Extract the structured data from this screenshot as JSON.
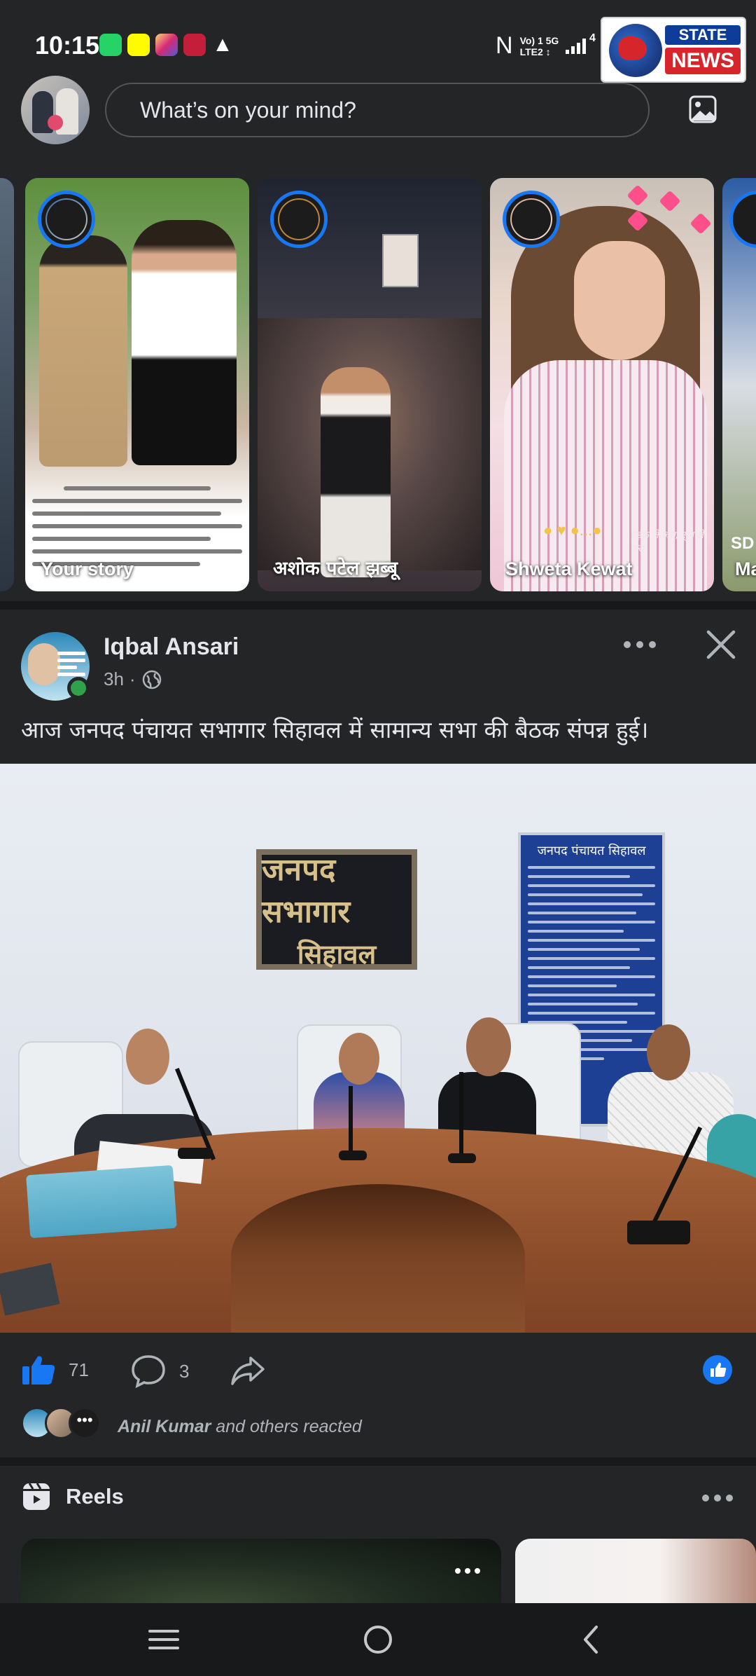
{
  "status_bar": {
    "time": "10:15",
    "network_line1": "Vo) 1 5G",
    "network_line2": "LTE2 ↕",
    "extra": "4",
    "notification_icons": [
      "whatsapp-icon",
      "snapchat-icon",
      "instagram-icon",
      "app-icon",
      "app-icon"
    ]
  },
  "watermark": {
    "word1": "STATE",
    "word2": "NEWS"
  },
  "composer": {
    "placeholder": "What’s on your mind?"
  },
  "stories": [
    {
      "name": ""
    },
    {
      "name": "Your story"
    },
    {
      "name": "अशोक पटेल झब्बू"
    },
    {
      "name": "Shweta Kewat",
      "caption": "धड़क ले जरा, सुन ले जरा"
    },
    {
      "name": "Ma",
      "tag": "SD"
    }
  ],
  "post": {
    "author": "Iqbal Ansari",
    "time": "3h",
    "text": "आज जनपद पंचायत सभागार सिहावल में सामान्य सभा की बैठक संपन्न हुई।",
    "photo": {
      "board_line1": "जनपद सभागार",
      "board_line2": "सिहावल",
      "board2_title": "जनपद पंचायत सिहावल"
    },
    "likes": "71",
    "comments": "3",
    "reacted_name": "Anil Kumar",
    "reacted_suffix": " and others reacted"
  },
  "reels": {
    "title": "Reels"
  },
  "colors": {
    "background": "#242526",
    "separator": "#18191a",
    "accent": "#1877f2",
    "online": "#31a24c"
  }
}
